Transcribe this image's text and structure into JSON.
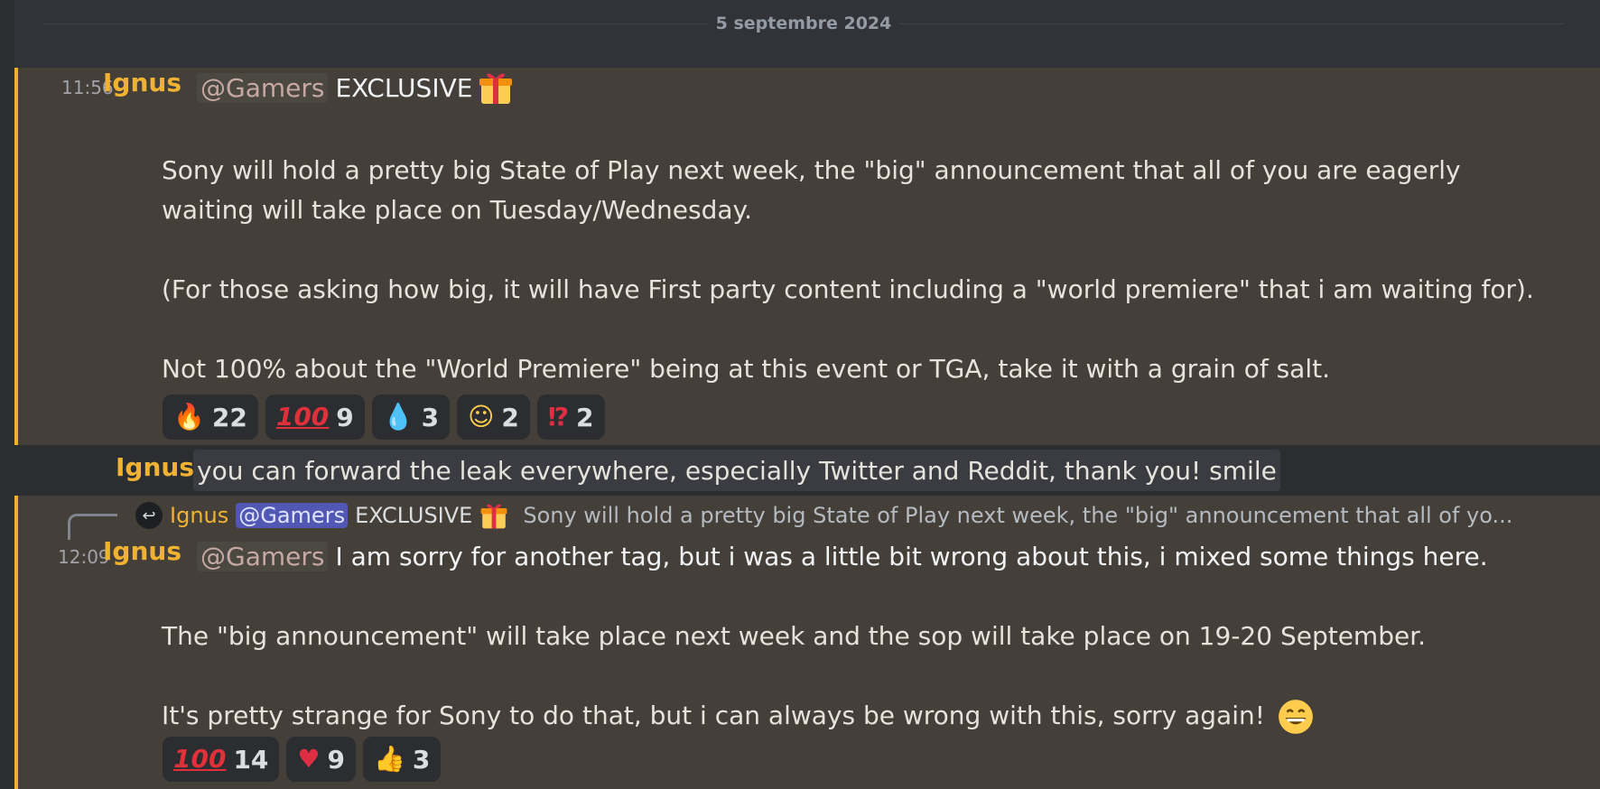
{
  "date_divider": "5 septembre 2024",
  "messages": [
    {
      "time": "11:56",
      "author": "Ignus",
      "mention": "@Gamers",
      "header_text": "EXCLUSIVE",
      "paragraphs": [
        "Sony will hold a pretty big State of Play next week, the \"big\" announcement that all of you are eagerly waiting will take place on Tuesday/Wednesday.",
        "(For those asking how big, it will have First party content including a \"world premiere\" that i am waiting for).",
        "Not 100% about the \"World Premiere\" being at this event or TGA, take it with a grain of salt."
      ],
      "reactions": [
        {
          "icon": "fire-emoji",
          "glyph": "🔥",
          "count": "22"
        },
        {
          "icon": "hundred-points-emoji",
          "glyph": "100",
          "count": "9"
        },
        {
          "icon": "drop-of-blood-emoji",
          "glyph": "💧",
          "count": "3"
        },
        {
          "icon": "baby-emoji",
          "glyph": "☺",
          "count": "2"
        },
        {
          "icon": "exclamation-question-emoji",
          "glyph": "⁉",
          "count": "2"
        }
      ]
    },
    {
      "author": "Ignus",
      "text": "you can forward the leak everywhere, especially Twitter and Reddit, thank you! smile"
    },
    {
      "time": "12:09",
      "author": "Ignus",
      "mention": "@Gamers",
      "header_text": "I am sorry for another tag, but i was a little bit wrong about this, i mixed some things here.",
      "reply": {
        "author": "Ignus",
        "mention": "@Gamers",
        "excl": "EXCLUSIVE",
        "preview": "Sony will hold a pretty big State of Play next week, the \"big\" announcement that all of yo..."
      },
      "paragraphs": [
        "The \"big announcement\" will take place next week and the sop will take place on 19-20 September.",
        "It's pretty strange for Sony to do that, but i can always be wrong with this, sorry again!"
      ],
      "reactions": [
        {
          "icon": "hundred-points-emoji",
          "glyph": "100",
          "count": "14"
        },
        {
          "icon": "red-heart-emoji",
          "glyph": "♥",
          "count": "9"
        },
        {
          "icon": "thumbs-up-emoji",
          "glyph": "👍",
          "count": "3"
        }
      ]
    }
  ],
  "colors": {
    "background": "#313338",
    "highlight": "#444039",
    "highlight_border": "#f0b132",
    "author": "#f0b232"
  }
}
